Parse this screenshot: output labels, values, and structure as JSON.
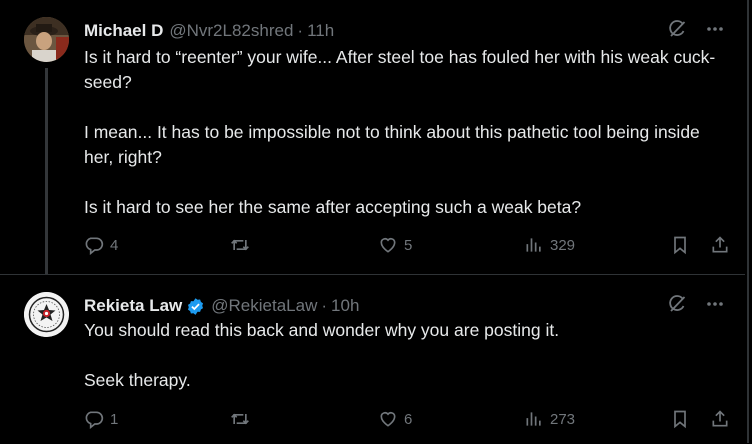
{
  "tweets": [
    {
      "name": "Michael D",
      "handle": "@Nvr2L82shred",
      "separator": "·",
      "time": "11h",
      "paragraphs": [
        "Is it hard to “reenter” your wife... After steel toe has fouled her with his weak cuck-seed?",
        "I mean... It has to be impossible not to think about this pathetic tool being inside her, right?",
        "Is it hard to see her the same after accepting such a weak beta?"
      ],
      "replies": "4",
      "reposts": "",
      "likes": "5",
      "views": "329"
    },
    {
      "name": "Rekieta Law",
      "handle": "@RekietaLaw",
      "separator": "·",
      "time": "10h",
      "verified": true,
      "paragraphs": [
        "You should read this back and wonder why you are posting it.",
        "Seek therapy."
      ],
      "replies": "1",
      "reposts": "",
      "likes": "6",
      "views": "273"
    }
  ],
  "colors": {
    "background": "#000000",
    "text": "#e7e9ea",
    "muted": "#71767b",
    "verified": "#1d9bf0",
    "divider": "#2f3336"
  },
  "icons": [
    "grok-icon",
    "more-icon",
    "reply-icon",
    "repost-icon",
    "like-icon",
    "views-icon",
    "bookmark-icon",
    "share-icon",
    "verified-badge-icon"
  ]
}
